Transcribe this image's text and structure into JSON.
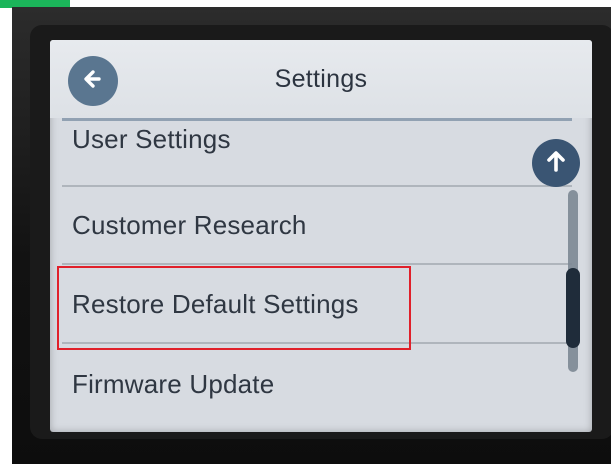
{
  "header": {
    "title": "Settings"
  },
  "menu": {
    "items": [
      {
        "label": "User Settings"
      },
      {
        "label": "Customer Research"
      },
      {
        "label": "Restore Default Settings"
      },
      {
        "label": "Firmware Update"
      }
    ]
  },
  "icons": {
    "back": "back-arrow-icon",
    "scroll_up": "arrow-up-icon"
  },
  "colors": {
    "screen_background": "#d7dbe1",
    "header_background": "#e3e6ea",
    "back_button": "#5a7690",
    "scroll_up_button": "#3a5573",
    "highlight": "#e0202a",
    "top_accent": "#1bb55a"
  }
}
